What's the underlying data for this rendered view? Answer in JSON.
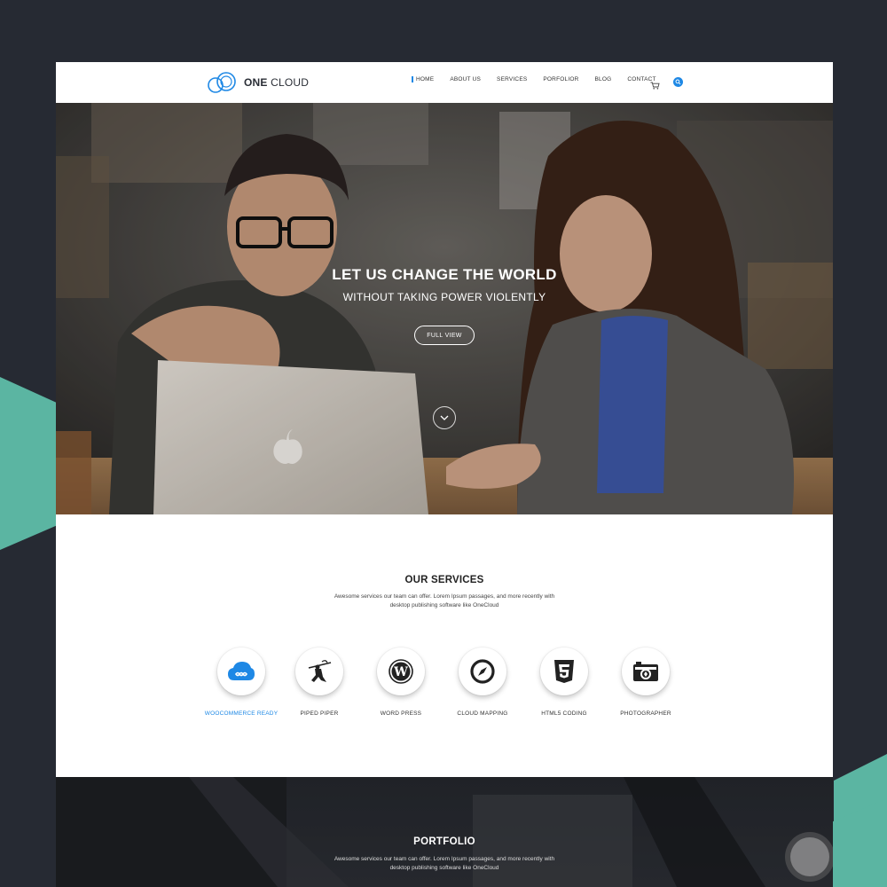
{
  "colors": {
    "background": "#262a33",
    "accent": "#1e88e5",
    "teal": "#5bb5a2"
  },
  "logo": {
    "bold": "ONE",
    "light": "CLOUD"
  },
  "nav": {
    "items": [
      "HOME",
      "ABOUT US",
      "SERVICES",
      "PORFOLIOR",
      "BLOG",
      "CONTACT"
    ],
    "active": "HOME",
    "cart_icon": "cart-icon",
    "search_icon": "search-icon"
  },
  "hero": {
    "title": "LET US CHANGE THE WORLD",
    "subtitle": "WITHOUT TAKING POWER VIOLENTLY",
    "button": "FULL VIEW",
    "scroll_icon": "chevron-down-icon"
  },
  "services": {
    "title": "OUR SERVICES",
    "description": "Awesome services our team can offer. Lorem Ipsum passages, and more recently with desktop publishing software like OneCloud",
    "items": [
      {
        "label": "WOOCOMMERCE READY",
        "icon": "cloud-infinity-icon",
        "active": true
      },
      {
        "label": "PIPED PIPER",
        "icon": "piper-icon",
        "active": false
      },
      {
        "label": "WORD PRESS",
        "icon": "wordpress-icon",
        "active": false
      },
      {
        "label": "CLOUD MAPPING",
        "icon": "compass-icon",
        "active": false
      },
      {
        "label": "HTML5 CODING",
        "icon": "html5-icon",
        "active": false
      },
      {
        "label": "PHOTOGRAPHER",
        "icon": "camera-icon",
        "active": false
      }
    ]
  },
  "portfolio": {
    "title": "PORTFOLIO",
    "description": "Awesome services our team can offer. Lorem Ipsum passages, and more recently with desktop publishing software like OneCloud"
  }
}
